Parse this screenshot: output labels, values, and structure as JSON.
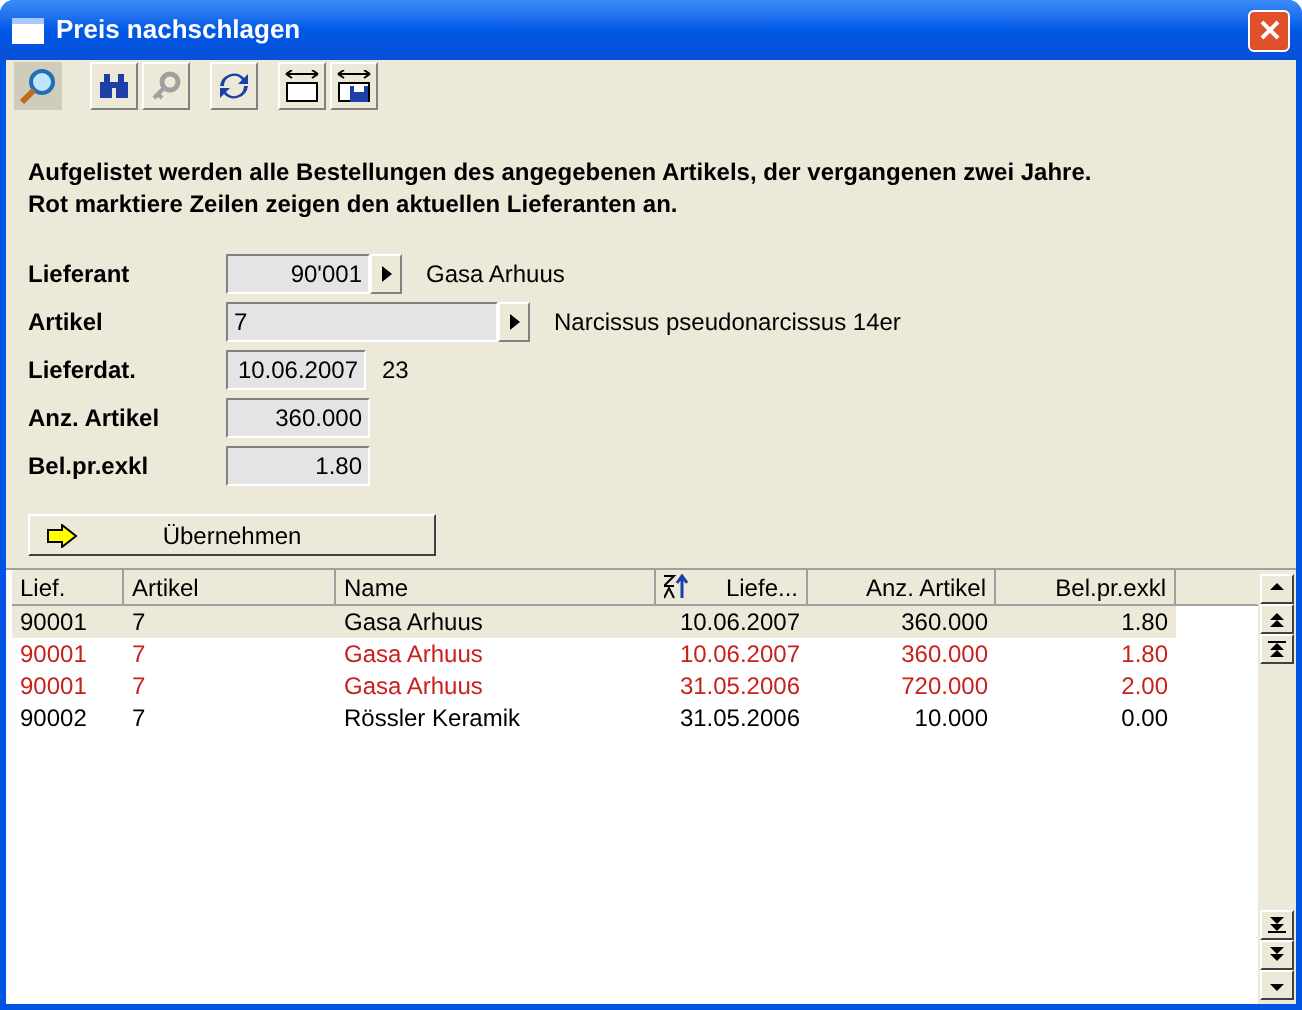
{
  "window": {
    "title": "Preis nachschlagen"
  },
  "toolbar": [
    {
      "kind": "search",
      "selected": true,
      "disabled": false
    },
    {
      "kind": "binoculars",
      "selected": false,
      "disabled": false
    },
    {
      "kind": "key",
      "selected": false,
      "disabled": true
    },
    {
      "kind": "refresh",
      "selected": false,
      "disabled": false
    },
    {
      "kind": "frame",
      "selected": false,
      "disabled": false
    },
    {
      "kind": "frame-save",
      "selected": false,
      "disabled": false
    }
  ],
  "info": [
    "Aufgelistet werden alle Bestellungen des angegebenen Artikels, der vergangenen zwei Jahre.",
    "Rot marktiere Zeilen zeigen den aktuellen Lieferanten an."
  ],
  "form": [
    {
      "label": "Lieferant",
      "value": "90'001",
      "kind": "lookup",
      "note": "Gasa Arhuus"
    },
    {
      "label": "Artikel",
      "value": "7",
      "kind": "lookup",
      "note": "Narcissus pseudonarcissus 14er"
    },
    {
      "label": "Lieferdat.",
      "value": "10.06.2007",
      "kind": "date",
      "note": "23"
    },
    {
      "label": "Anz. Artikel",
      "value": "360.000",
      "kind": "plain"
    },
    {
      "label": "Bel.pr.exkl",
      "value": "1.80",
      "kind": "plain"
    }
  ],
  "apply_button": {
    "label": "Übernehmen"
  },
  "table": {
    "columns": [
      {
        "label": "Lief.",
        "sorted": false
      },
      {
        "label": "Artikel",
        "sorted": false
      },
      {
        "label": "Name",
        "sorted": false
      },
      {
        "label": "Liefe...",
        "sorted": true
      },
      {
        "label": "Anz. Artikel",
        "sorted": false
      },
      {
        "label": "Bel.pr.exkl",
        "sorted": false
      }
    ],
    "rows": [
      {
        "cells": [
          "90001",
          "7",
          "Gasa Arhuus",
          "10.06.2007",
          "360.000",
          "1.80"
        ],
        "selected": true,
        "current": false
      },
      {
        "cells": [
          "90001",
          "7",
          "Gasa Arhuus",
          "10.06.2007",
          "360.000",
          "1.80"
        ],
        "selected": false,
        "current": true
      },
      {
        "cells": [
          "90001",
          "7",
          "Gasa Arhuus",
          "31.05.2006",
          "720.000",
          "2.00"
        ],
        "selected": false,
        "current": true
      },
      {
        "cells": [
          "90002",
          "7",
          "Rössler Keramik",
          "31.05.2006",
          "10.000",
          "0.00"
        ],
        "selected": false,
        "current": false
      }
    ]
  }
}
